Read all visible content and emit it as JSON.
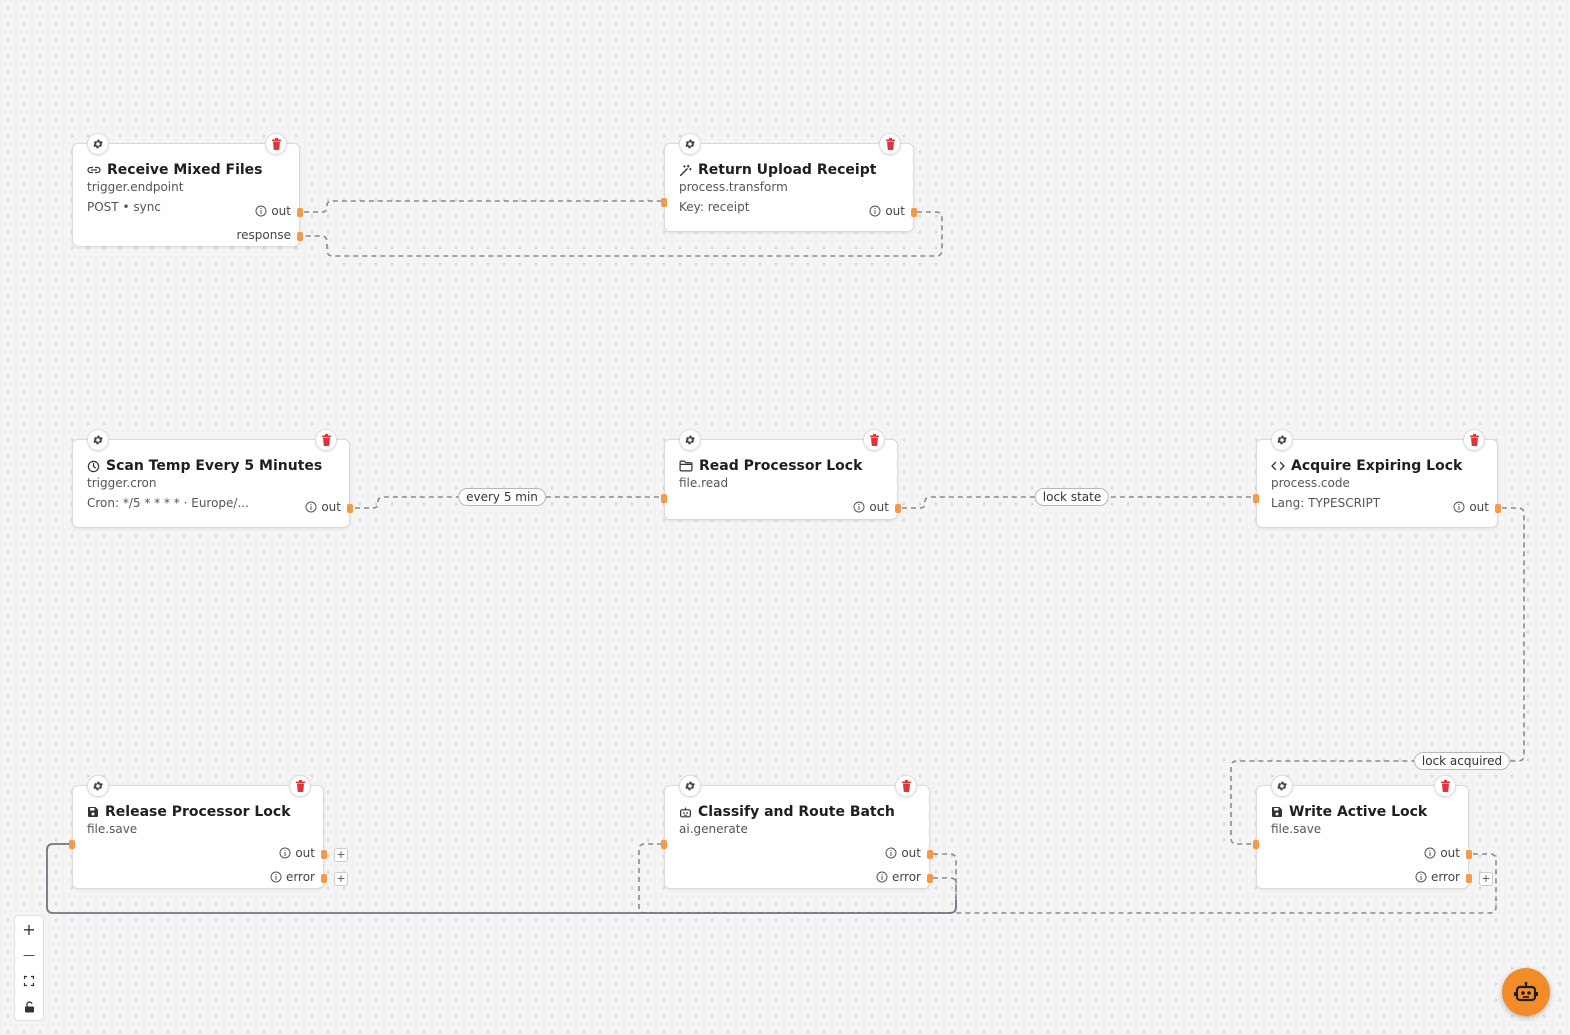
{
  "colors": {
    "port": "#f39a4a",
    "edge": "#8a8a8a",
    "edge_solid": "#6f7587",
    "trash": "#e0343a",
    "assistant": "#f28c28"
  },
  "nodes": {
    "receive_mixed_files": {
      "title": "Receive Mixed Files",
      "icon": "link-icon",
      "type": "trigger.endpoint",
      "detail": "POST • sync",
      "ports": {
        "out": "out",
        "response": "response"
      }
    },
    "return_upload_receipt": {
      "title": "Return Upload Receipt",
      "icon": "magic-wand-icon",
      "type": "process.transform",
      "detail": "Key: receipt",
      "ports": {
        "out": "out"
      }
    },
    "scan_temp": {
      "title": "Scan Temp Every 5 Minutes",
      "icon": "clock-icon",
      "type": "trigger.cron",
      "detail": "Cron: */5 * * * * · Europe/...",
      "ports": {
        "out": "out"
      }
    },
    "read_processor_lock": {
      "title": "Read Processor Lock",
      "icon": "folder-icon",
      "type": "file.read",
      "ports": {
        "out": "out"
      }
    },
    "acquire_expiring_lock": {
      "title": "Acquire Expiring Lock",
      "icon": "code-icon",
      "type": "process.code",
      "detail": "Lang: TYPESCRIPT",
      "ports": {
        "out": "out"
      }
    },
    "release_processor_lock": {
      "title": "Release Processor Lock",
      "icon": "save-icon",
      "type": "file.save",
      "ports": {
        "out": "out",
        "error": "error"
      }
    },
    "classify_route_batch": {
      "title": "Classify and Route Batch",
      "icon": "robot-icon",
      "type": "ai.generate",
      "ports": {
        "out": "out",
        "error": "error"
      }
    },
    "write_active_lock": {
      "title": "Write Active Lock",
      "icon": "save-icon",
      "type": "file.save",
      "ports": {
        "out": "out",
        "error": "error"
      }
    }
  },
  "edge_labels": {
    "every_5_min": "every 5 min",
    "lock_state": "lock state",
    "lock_acquired": "lock acquired"
  },
  "controls": {
    "zoom_in": "+",
    "zoom_out": "—",
    "plus_symbol": "+"
  }
}
